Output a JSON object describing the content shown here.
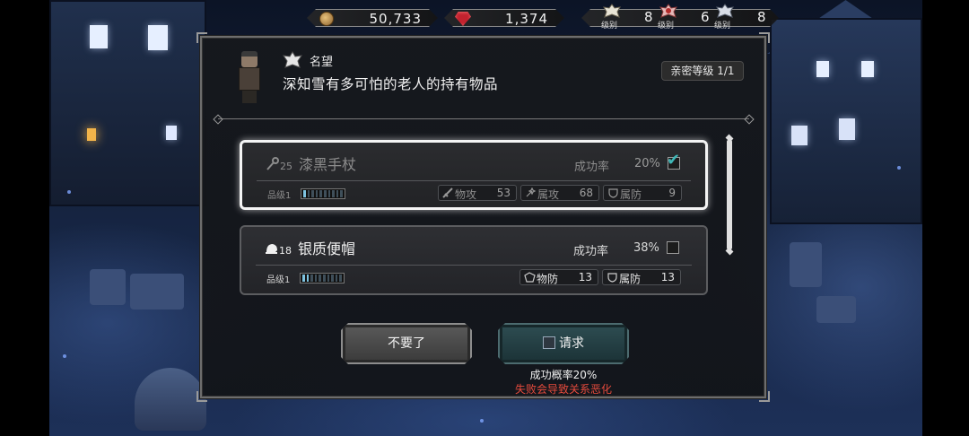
{
  "currency": {
    "coins": "50,733",
    "gems": "1,374"
  },
  "ranks": [
    {
      "icon": "white-rank-icon",
      "label": "级别",
      "count": "8"
    },
    {
      "icon": "red-rank-icon",
      "label": "级别",
      "count": "6"
    },
    {
      "icon": "silver-rank-icon",
      "label": "级别",
      "count": "8"
    }
  ],
  "dialog": {
    "skill_name": "名望",
    "title": "深知雪有多可怕的老人的持有物品",
    "intimacy": "亲密等级 1/1"
  },
  "items": [
    {
      "name": "漆黑手杖",
      "level": "25",
      "icon": "staff-icon",
      "rate_label": "成功率",
      "rate": "20%",
      "selected": true,
      "grade_label": "品级",
      "grade": "1",
      "stats": [
        {
          "label": "物攻",
          "value": "53",
          "icon": "sword-icon"
        },
        {
          "label": "属攻",
          "value": "68",
          "icon": "magic-icon"
        },
        {
          "label": "属防",
          "value": "9",
          "icon": "shield-icon"
        }
      ]
    },
    {
      "name": "银质便帽",
      "level": "18",
      "icon": "helmet-icon",
      "rate_label": "成功率",
      "rate": "38%",
      "selected": false,
      "grade_label": "品级",
      "grade": "1",
      "stats": [
        {
          "label": "物防",
          "value": "13",
          "icon": "armor-icon"
        },
        {
          "label": "属防",
          "value": "13",
          "icon": "shield-icon"
        }
      ]
    }
  ],
  "buttons": {
    "decline": "不要了",
    "request": "请求"
  },
  "footer": {
    "success": "成功概率20%",
    "warning": "失败会导致关系恶化"
  },
  "colors": {
    "accent_teal": "#3fb7b7",
    "warning_red": "#e64b3d"
  }
}
